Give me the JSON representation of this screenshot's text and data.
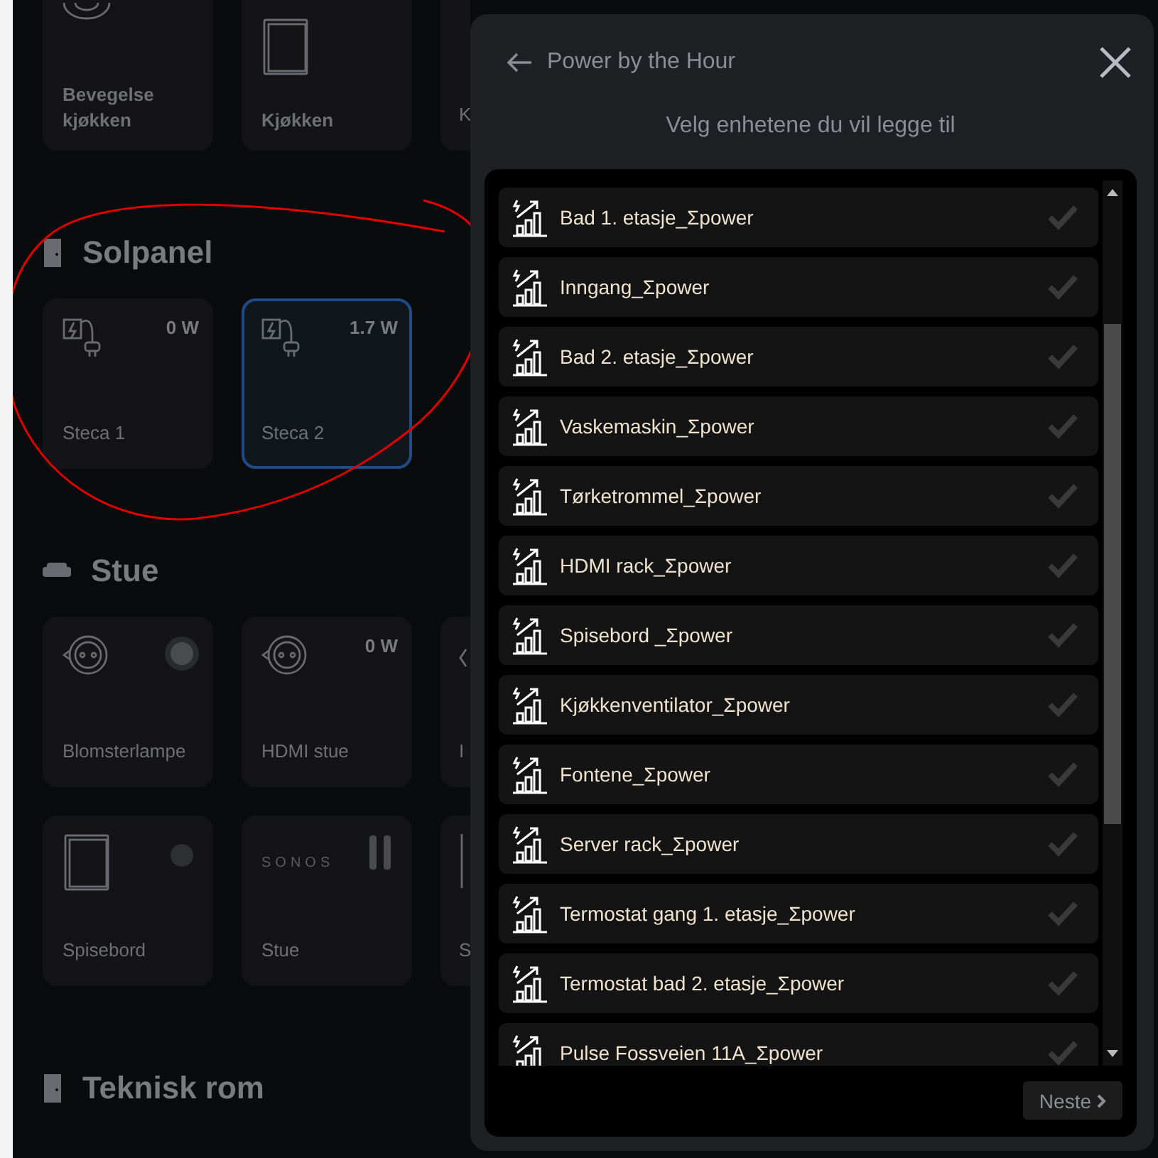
{
  "dashboard": {
    "top_cards": [
      {
        "name": "Bevegelse kjøkken",
        "kind": "sensor"
      },
      {
        "name": "Kjøkken",
        "kind": "switch"
      },
      {
        "name": "K",
        "kind": "blank"
      }
    ],
    "sections": [
      {
        "title": "Solpanel",
        "kind": "door",
        "cards": [
          {
            "name": "Steca 1",
            "kind": "inverter",
            "value": "0 W",
            "selected": false
          },
          {
            "name": "Steca 2",
            "kind": "inverter",
            "value": "1.7 W",
            "selected": true
          }
        ]
      },
      {
        "title": "Stue",
        "kind": "sofa",
        "cards": [
          {
            "name": "Blomsterlampe",
            "kind": "plug",
            "selected": false
          },
          {
            "name": "HDMI stue",
            "kind": "meter",
            "value": "0 W",
            "selected": false
          },
          {
            "name": "I",
            "kind": "meter",
            "selected": false
          },
          {
            "name": "Spisebord",
            "kind": "light",
            "selected": false
          },
          {
            "name": "Stue",
            "kind": "speaker",
            "brand": "SONOS",
            "selected": false
          },
          {
            "name": "S",
            "kind": "light",
            "selected": false
          }
        ]
      },
      {
        "title": "Teknisk rom",
        "kind": "door"
      }
    ]
  },
  "dialog": {
    "title": "Power by the Hour",
    "subtitle": "Velg enhetene du vil legge til",
    "items": [
      {
        "label": "Bad 1. etasje_Σpower",
        "checked": false
      },
      {
        "label": "Inngang_Σpower",
        "checked": false
      },
      {
        "label": "Bad 2. etasje_Σpower",
        "checked": false
      },
      {
        "label": "Vaskemaskin_Σpower",
        "checked": false
      },
      {
        "label": "Tørketrommel_Σpower",
        "checked": false
      },
      {
        "label": "HDMI rack_Σpower",
        "checked": false
      },
      {
        "label": "Spisebord _Σpower",
        "checked": false
      },
      {
        "label": "Kjøkkenventilator_Σpower",
        "checked": false
      },
      {
        "label": "Fontene_Σpower",
        "checked": false
      },
      {
        "label": "Server rack_Σpower",
        "checked": false
      },
      {
        "label": "Termostat gang 1. etasje_Σpower",
        "checked": false
      },
      {
        "label": "Termostat bad 2. etasje_Σpower",
        "checked": false
      },
      {
        "label": "Pulse Fossveien 11A_Σpower",
        "checked": false
      }
    ],
    "next_button": "Neste"
  }
}
